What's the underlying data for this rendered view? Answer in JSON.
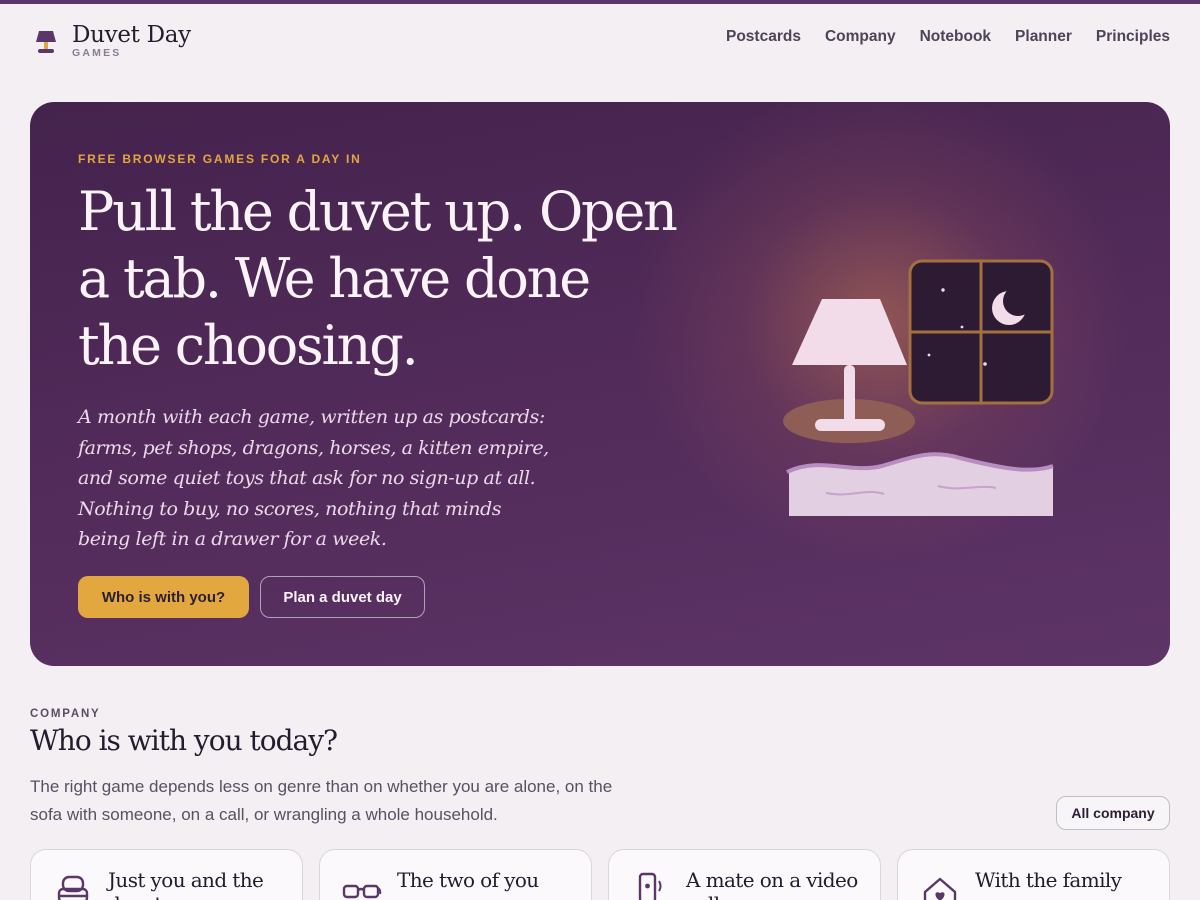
{
  "brand": {
    "name": "Duvet Day",
    "sub": "GAMES"
  },
  "nav": [
    {
      "label": "Postcards"
    },
    {
      "label": "Company"
    },
    {
      "label": "Notebook"
    },
    {
      "label": "Planner"
    },
    {
      "label": "Principles"
    }
  ],
  "hero": {
    "eyebrow": "FREE BROWSER GAMES FOR A DAY IN",
    "title": "Pull the duvet up. Open a tab. We have done the choosing.",
    "body": "A month with each game, written up as postcards: farms, pet shops, dragons, horses, a kitten empire, and some quiet toys that ask for no sign-up at all. Nothing to buy, no scores, nothing that minds being left in a drawer for a week.",
    "primary_button": "Who is with you?",
    "secondary_button": "Plan a duvet day"
  },
  "company": {
    "eyebrow": "COMPANY",
    "title": "Who is with you today?",
    "body": "The right game depends less on genre than on whether you are alone, on the sofa with someone, on a call, or wrangling a whole household.",
    "all_button": "All company",
    "cards": [
      {
        "title": "Just you and the duvet",
        "icon": "armchair-icon"
      },
      {
        "title": "The two of you",
        "icon": "glasses-icon"
      },
      {
        "title": "A mate on a video call",
        "icon": "phone-call-icon"
      },
      {
        "title": "With the family",
        "icon": "house-heart-icon"
      }
    ]
  },
  "colors": {
    "accent": "#e2a83f",
    "hero_bg": "#522b5a",
    "page_bg": "#f4eff3",
    "topbar": "#5a3768"
  }
}
